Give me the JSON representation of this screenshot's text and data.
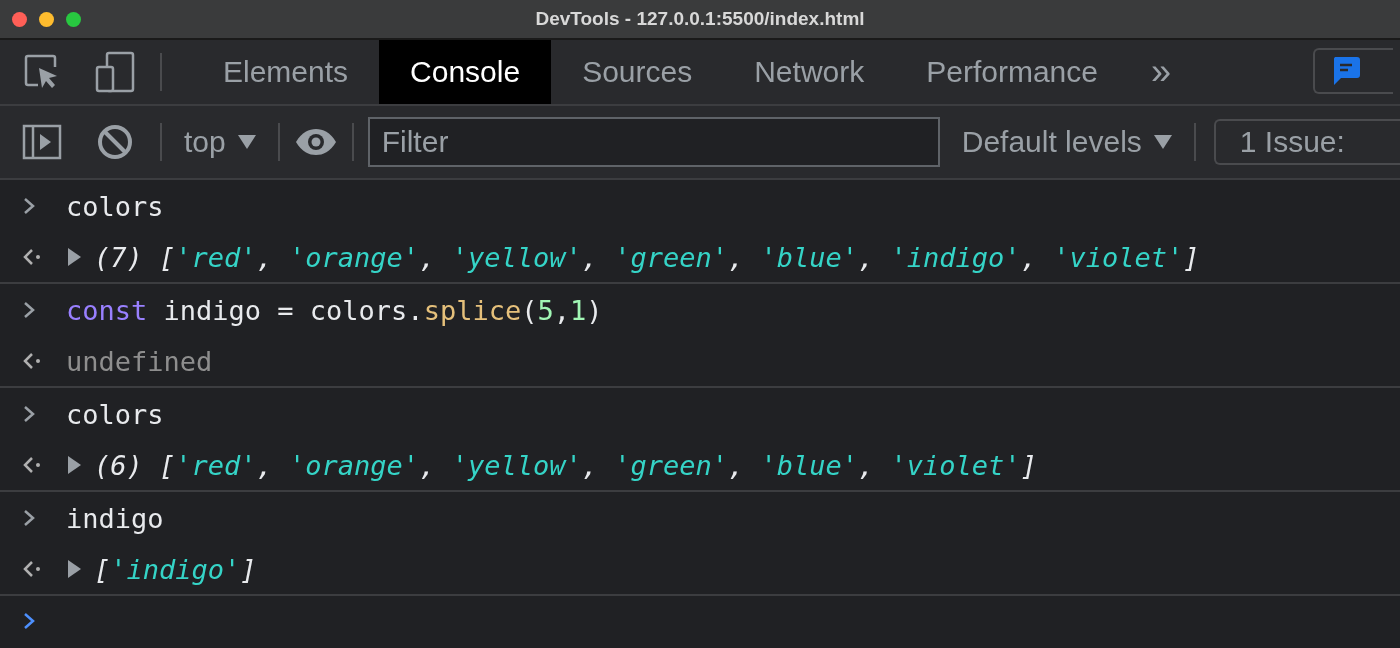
{
  "window": {
    "title": "DevTools - 127.0.0.1:5500/index.html"
  },
  "tabs": [
    {
      "label": "Elements",
      "selected": false
    },
    {
      "label": "Console",
      "selected": true
    },
    {
      "label": "Sources",
      "selected": false
    },
    {
      "label": "Network",
      "selected": false
    },
    {
      "label": "Performance",
      "selected": false
    }
  ],
  "more_tabs": "»",
  "toolbar": {
    "context": "top",
    "filter": {
      "placeholder": "Filter"
    },
    "levels": "Default levels",
    "issues": "1 Issue:"
  },
  "console": [
    {
      "kind": "input",
      "tokens": [
        {
          "kind": "plain",
          "text": "colors"
        }
      ]
    },
    {
      "kind": "output",
      "expanded": false,
      "tokens": [
        {
          "kind": "meta",
          "text": "(7) ["
        },
        {
          "kind": "string",
          "text": "'red'"
        },
        {
          "kind": "meta",
          "text": ", "
        },
        {
          "kind": "string",
          "text": "'orange'"
        },
        {
          "kind": "meta",
          "text": ", "
        },
        {
          "kind": "string",
          "text": "'yellow'"
        },
        {
          "kind": "meta",
          "text": ", "
        },
        {
          "kind": "string",
          "text": "'green'"
        },
        {
          "kind": "meta",
          "text": ", "
        },
        {
          "kind": "string",
          "text": "'blue'"
        },
        {
          "kind": "meta",
          "text": ", "
        },
        {
          "kind": "string",
          "text": "'indigo'"
        },
        {
          "kind": "meta",
          "text": ", "
        },
        {
          "kind": "string",
          "text": "'violet'"
        },
        {
          "kind": "meta",
          "text": "]"
        }
      ]
    },
    {
      "kind": "input",
      "tokens": [
        {
          "kind": "keyword",
          "text": "const"
        },
        {
          "kind": "plain",
          "text": " indigo = colors."
        },
        {
          "kind": "function",
          "text": "splice"
        },
        {
          "kind": "plain",
          "text": "("
        },
        {
          "kind": "number",
          "text": "5"
        },
        {
          "kind": "plain",
          "text": ","
        },
        {
          "kind": "number",
          "text": "1"
        },
        {
          "kind": "plain",
          "text": ")"
        }
      ]
    },
    {
      "kind": "output",
      "tokens": [
        {
          "kind": "muted",
          "text": "undefined"
        }
      ]
    },
    {
      "kind": "input",
      "tokens": [
        {
          "kind": "plain",
          "text": "colors"
        }
      ]
    },
    {
      "kind": "output",
      "expanded": false,
      "tokens": [
        {
          "kind": "meta",
          "text": "(6) ["
        },
        {
          "kind": "string",
          "text": "'red'"
        },
        {
          "kind": "meta",
          "text": ", "
        },
        {
          "kind": "string",
          "text": "'orange'"
        },
        {
          "kind": "meta",
          "text": ", "
        },
        {
          "kind": "string",
          "text": "'yellow'"
        },
        {
          "kind": "meta",
          "text": ", "
        },
        {
          "kind": "string",
          "text": "'green'"
        },
        {
          "kind": "meta",
          "text": ", "
        },
        {
          "kind": "string",
          "text": "'blue'"
        },
        {
          "kind": "meta",
          "text": ", "
        },
        {
          "kind": "string",
          "text": "'violet'"
        },
        {
          "kind": "meta",
          "text": "]"
        }
      ]
    },
    {
      "kind": "input",
      "tokens": [
        {
          "kind": "plain",
          "text": "indigo"
        }
      ]
    },
    {
      "kind": "output",
      "expanded": false,
      "tokens": [
        {
          "kind": "meta",
          "text": "["
        },
        {
          "kind": "string",
          "text": "'indigo'"
        },
        {
          "kind": "meta",
          "text": "]"
        }
      ]
    },
    {
      "kind": "prompt"
    }
  ]
}
